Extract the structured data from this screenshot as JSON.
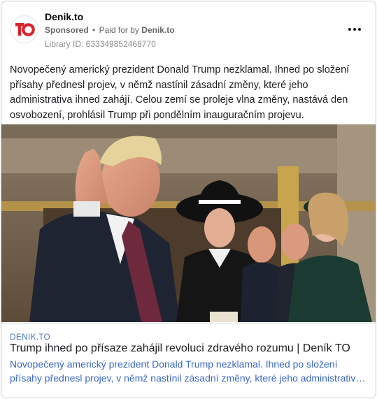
{
  "ad": {
    "page_name": "Denik.to",
    "sponsored_label": "Sponsored",
    "separator": "•",
    "paid_for_prefix": "Paid for by",
    "paid_for_page": "Denik.to",
    "library_id": "Library ID: 633349852468770",
    "logo_text": "TO",
    "body_text": "Novopečený americký prezident Donald Trump nezklamal. Ihned po složení přísahy přednesl projev, v němž nastínil zásadní změny, které jeho administrativa ihned zahájí. Celou zemí se proleje vlna změny, nastává den osvobození, prohlásil Trump při pondělním inauguračním projevu."
  },
  "link": {
    "domain": "DENIK.TO",
    "title": "Trump ihned po přísaze zahájil revoluci zdravého rozumu | Deník TO",
    "description": "Novopečený americký prezident Donald Trump nezklamal. Ihned po složení přísahy přednesl projev, v němž nastínil zásadní změny, které jeho administrativa ihned zahájí."
  },
  "icons": {
    "logo": "denik-to-logo-icon",
    "more": "more-options-icon"
  },
  "colors": {
    "logo_red": "#d8232a",
    "link_blue": "#3a68c6",
    "domain_blue": "#4a78b8"
  }
}
